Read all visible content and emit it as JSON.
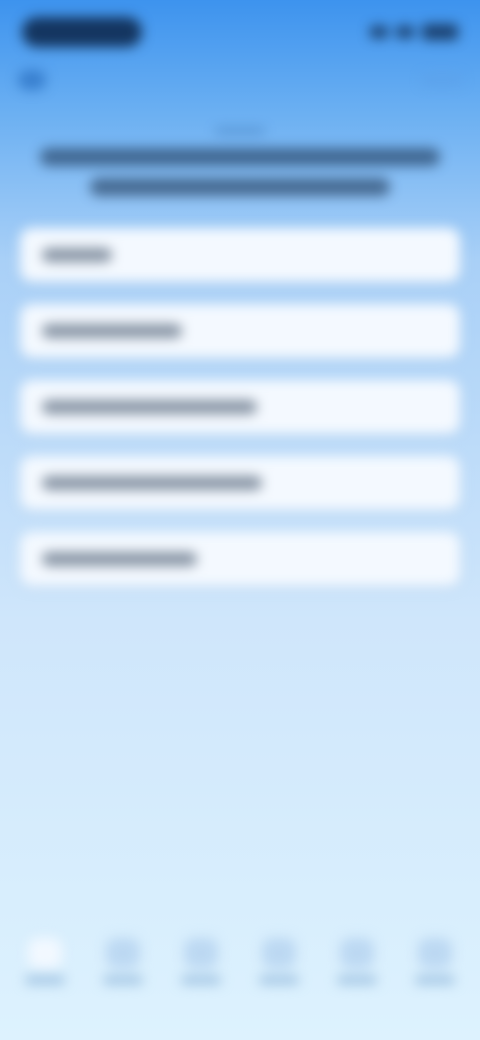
{
  "status_bar": {
    "left_pill": "",
    "right_icons": [
      "signal-icon",
      "wifi-icon",
      "battery-icon"
    ]
  },
  "nav": {
    "back_icon": "back-icon",
    "right_icon": "more-icon"
  },
  "headline": {
    "kicker": "",
    "line1": "",
    "line2": ""
  },
  "options": [
    {
      "label": "",
      "text_width": 70
    },
    {
      "label": "",
      "text_width": 140
    },
    {
      "label": "",
      "text_width": 215
    },
    {
      "label": "",
      "text_width": 220
    },
    {
      "label": "",
      "text_width": 155
    }
  ],
  "tabs": [
    {
      "icon": "home-icon",
      "label": "",
      "active": true
    },
    {
      "icon": "chart-icon",
      "label": "",
      "active": false
    },
    {
      "icon": "list-icon",
      "label": "",
      "active": false
    },
    {
      "icon": "bell-icon",
      "label": "",
      "active": false
    },
    {
      "icon": "profile-icon",
      "label": "",
      "active": false
    },
    {
      "icon": "settings-icon",
      "label": "",
      "active": false
    }
  ],
  "colors": {
    "background_top": "#3d93ee",
    "background_bottom": "#ddf2fe",
    "card_background": "#f4f9ff",
    "text_dark": "#0f1f33"
  }
}
